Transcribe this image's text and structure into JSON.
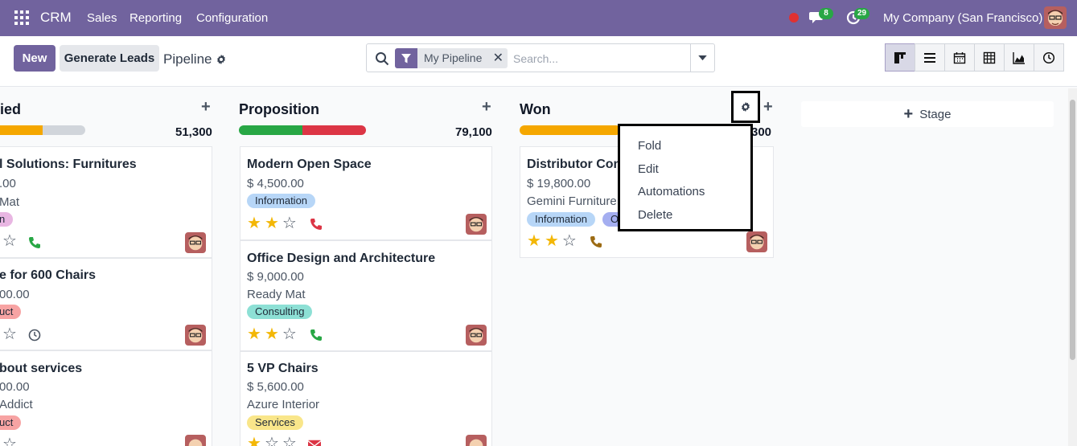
{
  "navbar": {
    "brand": "CRM",
    "menu": [
      "Sales",
      "Reporting",
      "Configuration"
    ],
    "messages_count": "8",
    "activities_count": "29",
    "company": "My Company (San Francisco)"
  },
  "control": {
    "new_label": "New",
    "generate_label": "Generate Leads",
    "breadcrumb": "Pipeline",
    "facet_label": "My Pipeline",
    "search_placeholder": "Search..."
  },
  "columns": [
    {
      "title": "ied",
      "total": "51,300"
    },
    {
      "title": "Proposition",
      "total": "79,100"
    },
    {
      "title": "Won",
      "total": "300"
    }
  ],
  "cards_col1": [
    {
      "title": "l Solutions: Furnitures",
      "amount": ".00",
      "company": "Mat",
      "tag": "n"
    },
    {
      "title": "e for 600 Chairs",
      "amount": "00.00",
      "tag": "uct"
    },
    {
      "title": "bout services",
      "amount": "00.00",
      "company": "Addict",
      "tag": "uct"
    }
  ],
  "cards_col2": [
    {
      "title": "Modern Open Space",
      "amount": "$ 4,500.00",
      "tag": "Information"
    },
    {
      "title": "Office Design and Architecture",
      "amount": "$ 9,000.00",
      "company": "Ready Mat",
      "tag": "Consulting"
    },
    {
      "title": "5 VP Chairs",
      "amount": "$ 5,600.00",
      "company": "Azure Interior",
      "tag": "Services"
    }
  ],
  "cards_col3": [
    {
      "title": "Distributor Con",
      "amount": "$ 19,800.00",
      "company": "Gemini Furniture",
      "tag": "Information",
      "tag2": "O"
    }
  ],
  "stage_add_label": "Stage",
  "dropdown": [
    "Fold",
    "Edit",
    "Automations",
    "Delete"
  ],
  "colors": {
    "brand": "#71639e",
    "success": "#28a745",
    "danger": "#dc3545",
    "warning": "#f5a700",
    "star": "#f3b707"
  }
}
